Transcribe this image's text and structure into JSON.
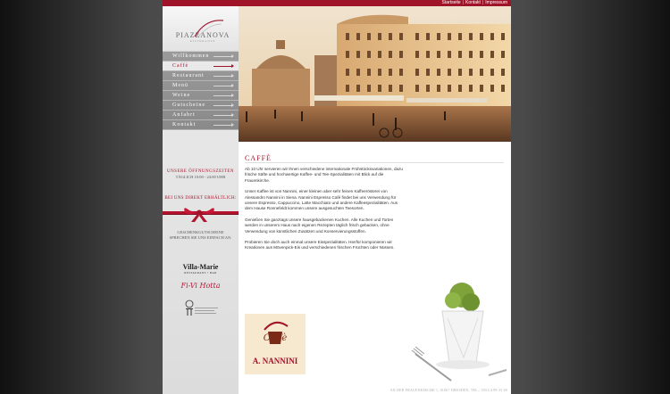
{
  "top_links": [
    "Startseite",
    "Kontakt",
    "Impressum"
  ],
  "brand": {
    "name": "PIAZZANOVA",
    "tagline": "RISTORANTE"
  },
  "nav": [
    {
      "label": "Willkommen",
      "active": false
    },
    {
      "label": "Caffè",
      "active": true
    },
    {
      "label": "Restaurant",
      "active": false
    },
    {
      "label": "Menü",
      "active": false
    },
    {
      "label": "Weine",
      "active": false
    },
    {
      "label": "Gutscheine",
      "active": false
    },
    {
      "label": "Anfahrt",
      "active": false
    },
    {
      "label": "Kontakt",
      "active": false
    }
  ],
  "hours": {
    "title": "Unsere Öffnungszeiten",
    "value": "Täglich 10:00 - 24:00 Uhr"
  },
  "gift": {
    "title": "Bei uns direkt erhältlich:",
    "text_line1": "Geschenkgutscheine",
    "text_line2": "sprechen Sie uns einfach an."
  },
  "partners": {
    "villa_marie": "Villa-Marie",
    "villa_marie_sub": "RESTAURANT • BAR",
    "fivi": "Fi-Vi Hotta"
  },
  "content": {
    "title": "Caffè",
    "paragraphs": [
      "Ab 10 Uhr servieren wir Ihnen verschiedene internationale Frühstücksvariationen, dazu frische Säfte und hochwertige Kaffee- und Tee-Spezialitäten mit Blick auf die Frauenkirche.",
      "Unser Kaffee ist von Nannini, einer kleinen aber sehr feinen Kaffeerösterei von Alessandro Nannini in Siena. Nannini Espresso Café findet bei uns Verwendung für unsere Espresso, Cappuccino, Latte Macchiato und andere Kaffeespezialitäten. Aus dem Hause Ronnefeldt kommen unsere ausgesuchten Teesorten.",
      "Genießen Sie ganztags unsere hausgebackenen Kuchen. Alle Kuchen und Torten werden in unserem Haus nach eigenen Rezepten täglich frisch gebacken, ohne Verwendung von künstlichen Zusätzen und Konservierungsstoffen.",
      "Probieren Sie doch auch einmal unsere Eisspezialitäten. Hierfür komponieren wir Kreationen aus Mövenpick-Eis und verschiedenen frischen Früchten oder Nüssen."
    ]
  },
  "nannini_logo": {
    "caffe": "Caffè",
    "name": "A. NANNINI"
  },
  "footer": "An der Frauenkirche 1, 01067 Dresden, Tel.: 0351/4 98 33 60",
  "colors": {
    "accent": "#a0142a",
    "nav_bg": "#8f8f8f",
    "page_bg": "#4a4a4a"
  }
}
